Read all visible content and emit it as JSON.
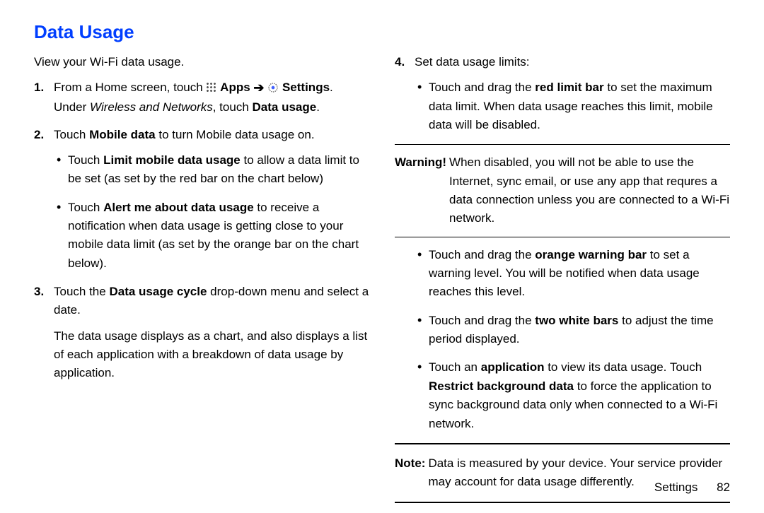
{
  "heading": "Data Usage",
  "intro": "View your Wi-Fi data usage.",
  "left": {
    "step1": {
      "marker": "1.",
      "pre": "From a Home screen, touch",
      "apps": "Apps",
      "settings": "Settings",
      "post": ".",
      "line2_pre": "Under",
      "line2_sect": "Wireless and Networks",
      "line2_mid": ", touch",
      "line2_bold": "Data usage",
      "line2_end": "."
    },
    "step2": {
      "marker": "2.",
      "text_pre": "Touch",
      "text_bold": "Mobile data",
      "text_post": "to turn Mobile data usage on.",
      "b1_pre": "Touch",
      "b1_bold": "Limit mobile data usage",
      "b1_post": "to allow a data limit to be set (as set by the red bar on the chart below)",
      "b2_pre": "Touch",
      "b2_bold": "Alert me about data usage",
      "b2_post": "to receive a notification when data usage is getting close to your mobile data limit (as set by the orange bar on the chart below)."
    },
    "step3": {
      "marker": "3.",
      "text_pre": "Touch the",
      "text_bold": "Data usage cycle",
      "text_post": "drop-down menu and select a date.",
      "para": "The data usage displays as a chart, and also displays a list of each application with a breakdown of data usage by application."
    }
  },
  "right": {
    "step4": {
      "marker": "4.",
      "text": "Set data usage limits:",
      "b1_pre": "Touch and drag the",
      "b1_bold": "red limit bar",
      "b1_post": "to set the maximum data limit. When data usage reaches this limit, mobile data will be disabled."
    },
    "warning": {
      "label": "Warning!",
      "text": "When disabled, you will not be able to use the Internet, sync email, or use any app that requres a data connection unless you are connected to a Wi-Fi network."
    },
    "bullets": {
      "b2_pre": "Touch and drag the",
      "b2_bold": "orange warning bar",
      "b2_post": "to set a warning level. You will be notified when data usage reaches this level.",
      "b3_pre": "Touch and drag the",
      "b3_bold": "two white bars",
      "b3_post": "to adjust the time period displayed.",
      "b4_pre": "Touch an",
      "b4_bold1": "application",
      "b4_mid": "to view its data usage. Touch",
      "b4_bold2": "Restrict background data",
      "b4_post": "to force the application to sync background data only when connected to a Wi-Fi network."
    },
    "note": {
      "label": "Note:",
      "text": "Data is measured by your device. Your service provider may account for data usage differently."
    }
  },
  "footer": {
    "section": "Settings",
    "page": "82"
  }
}
